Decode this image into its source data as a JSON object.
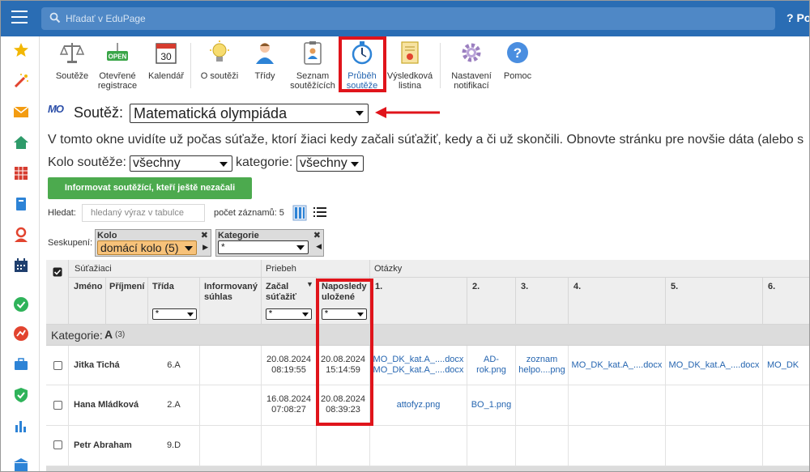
{
  "topbar": {
    "search_placeholder": "Hľadať v EduPage",
    "right_label": "? Po"
  },
  "toolbar": {
    "items": [
      {
        "label": "Soutěže"
      },
      {
        "label": "Otevřené registrace",
        "badge": "OPEN"
      },
      {
        "label": "Kalendář",
        "badge": "30"
      },
      {
        "label": "O soutěži"
      },
      {
        "label": "Třídy"
      },
      {
        "label": "Seznam soutěžících"
      },
      {
        "label": "Průběh soutěže"
      },
      {
        "label": "Výsledková listina"
      },
      {
        "label": "Nastavení notifikací"
      },
      {
        "label": "Pomoc"
      }
    ]
  },
  "heading": {
    "logo": "MO",
    "label": "Soutěž:",
    "selected": "Matematická olympiáda"
  },
  "info_text": "V tomto okne uvidíte už počas súťaže, ktorí žiaci kedy začali súťažiť, kedy a či už skončili. Obnovte stránku pre novšie dáta (alebo s",
  "filters": {
    "kolo_label": "Kolo soutěže:",
    "kolo_value": "všechny",
    "kategorie_label": "kategorie:",
    "kategorie_value": "všechny"
  },
  "notify_button": "Informovat soutěžící, kteří ještě nezačali soutěžit",
  "search": {
    "label": "Hledat:",
    "placeholder": "hledaný výraz v tabulce",
    "count": "počet záznamů: 5"
  },
  "grouping": {
    "label": "Seskupení:",
    "group1": {
      "title": "Kolo",
      "value": "domácí kolo (5)"
    },
    "group2": {
      "title": "Kategorie",
      "value": "*"
    }
  },
  "table": {
    "groups": {
      "students": "Súťažiaci",
      "progress": "Priebeh",
      "questions": "Otázky"
    },
    "columns": {
      "jmeno": "Jméno",
      "prijmeni": "Příjmení",
      "trida": "Třída",
      "informed": "Informovaný súhlas",
      "start": "Začal súťažiť",
      "saved": "Naposledy uložené",
      "q1": "1.",
      "q2": "2.",
      "q3": "3.",
      "q4": "4.",
      "q5": "5.",
      "q6": "6."
    },
    "filter_value": "*",
    "category_label": "Kategorie:",
    "category_value": "A",
    "category_count": "(3)",
    "rows": [
      {
        "name": "Jitka Tichá",
        "class": "6.A",
        "start_date": "20.08.2024",
        "start_time": "08:19:55",
        "saved_date": "20.08.2024",
        "saved_time": "15:14:59",
        "q1a": "MO_DK_kat.A_....docx",
        "q1b": "MO_DK_kat.A_....docx",
        "q2a": "AD-",
        "q2b": "rok.png",
        "q3a": "zoznam",
        "q3b": "helpo....png",
        "q4": "MO_DK_kat.A_....docx",
        "q5": "MO_DK_kat.A_....docx",
        "q6": "MO_DK"
      },
      {
        "name": "Hana Mládková",
        "class": "2.A",
        "start_date": "16.08.2024",
        "start_time": "07:08:27",
        "saved_date": "20.08.2024",
        "saved_time": "08:39:23",
        "q1": "attofyz.png",
        "q2": "BO_1.png"
      },
      {
        "name": "Petr Abraham",
        "class": "9.D"
      }
    ]
  },
  "colors": {
    "topbar": "#2a6db4",
    "accent_green": "#4caa4e",
    "highlight": "#e0141b",
    "link": "#2565b0",
    "group_select": "#f7c27a"
  }
}
